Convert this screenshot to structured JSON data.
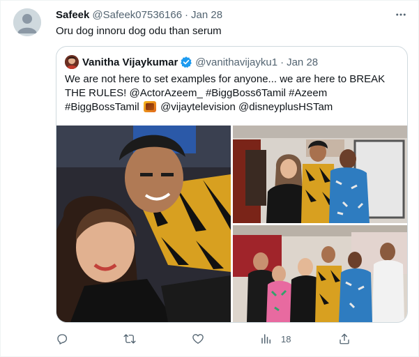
{
  "tweet": {
    "author_name": "Safeek",
    "author_handle": "@Safeek07536166",
    "separator": "·",
    "time": "Jan 28",
    "text": "Oru dog innoru dog odu than serum",
    "more_icon": "more-horizontal-icon"
  },
  "quote": {
    "author_name": "Vanitha Vijaykumar",
    "verified_icon": "verified-badge-icon",
    "verified_color": "#1d9bf0",
    "author_handle": "@vanithavijayku1",
    "separator": "·",
    "time": "Jan 28",
    "text_line1": "We are not here to set examples for anyone... we are here to BREAK",
    "text_line2": "THE RULES! @ActorAzeem_ #BiggBoss6Tamil #Azeem",
    "text_line3a": "#BiggBossTamil",
    "text_line3b": "@vijaytelevision @disneyplusHSTam",
    "hashtag_emoji_icon": "bigg-boss-hashflag-icon",
    "images": [
      "selfie-photo",
      "group-photo-1",
      "group-photo-2"
    ]
  },
  "actions": {
    "reply_icon": "reply-icon",
    "retweet_icon": "retweet-icon",
    "like_icon": "heart-icon",
    "views_icon": "views-icon",
    "views_count": "18",
    "share_icon": "share-icon"
  },
  "colors": {
    "text_primary": "#0f1419",
    "text_secondary": "#536471",
    "border": "#cfd9de"
  }
}
